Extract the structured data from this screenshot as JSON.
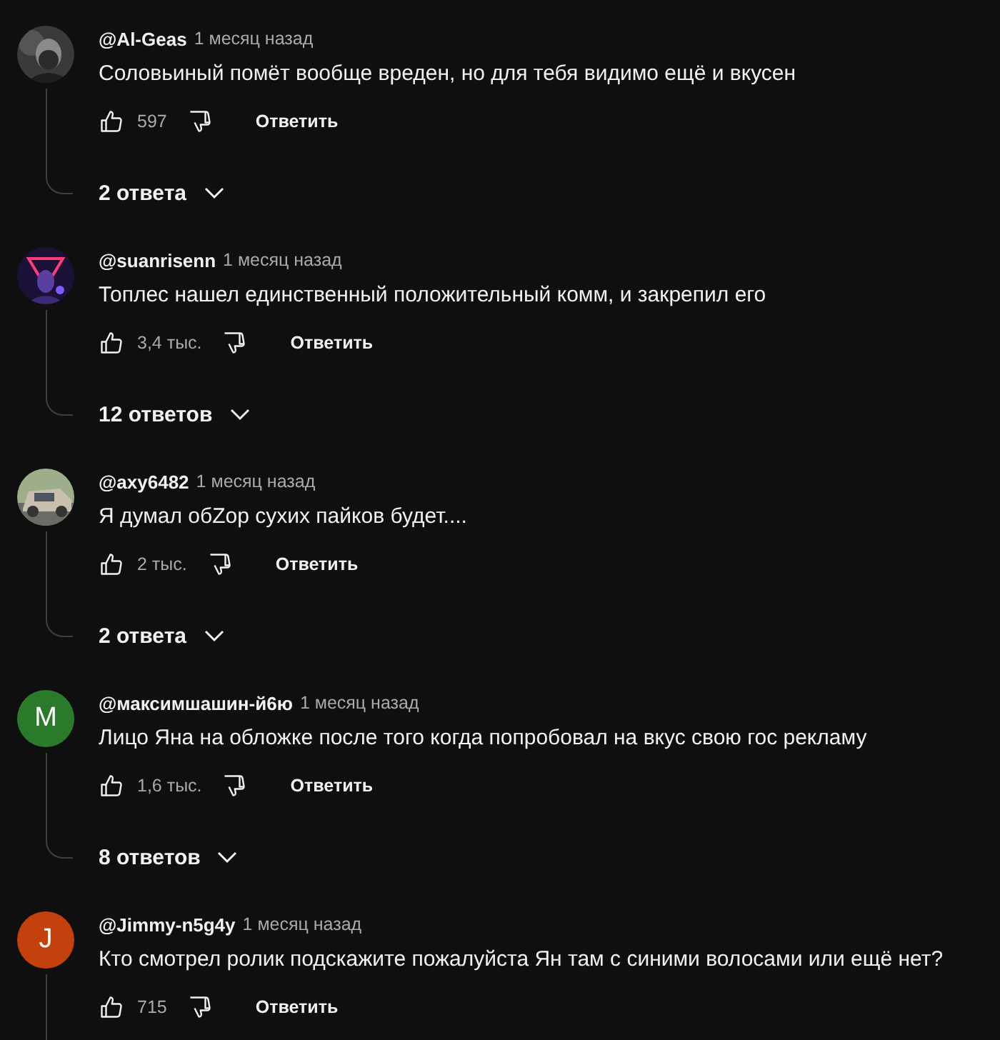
{
  "comments": [
    {
      "author": "@Al-Geas",
      "time": "1 месяц назад",
      "text": "Соловьиный помёт вообще вреден, но для тебя видимо ещё и вкусен",
      "likes": "597",
      "reply_button": "Ответить",
      "replies": "2 ответа"
    },
    {
      "author": "@suanrisenn",
      "time": "1 месяц назад",
      "text": "Топлес нашел единственный положительный комм, и закрепил его",
      "likes": "3,4 тыс.",
      "reply_button": "Ответить",
      "replies": "12 ответов"
    },
    {
      "author": "@axy6482",
      "time": "1 месяц назад",
      "text": "Я думал обZор сухих пайков будет....",
      "likes": "2 тыс.",
      "reply_button": "Ответить",
      "replies": "2 ответа"
    },
    {
      "avatar": {
        "kind": "letter",
        "letter": "М",
        "color": "#2b7a2b"
      },
      "author": "@максимшашин-й6ю",
      "time": "1 месяц назад",
      "text": "Лицо Яна на обложке после того когда попробовал на вкус свою гос рекламу",
      "likes": "1,6 тыс.",
      "reply_button": "Ответить",
      "replies": "8 ответов"
    },
    {
      "avatar": {
        "kind": "letter",
        "letter": "J",
        "color": "#c2410c"
      },
      "author": "@Jimmy-n5g4y",
      "time": "1 месяц назад",
      "text": "Кто смотрел ролик подскажите пожалуйста Ян там с синими волосами или ещё нет?",
      "likes": "715",
      "reply_button": "Ответить"
    }
  ]
}
